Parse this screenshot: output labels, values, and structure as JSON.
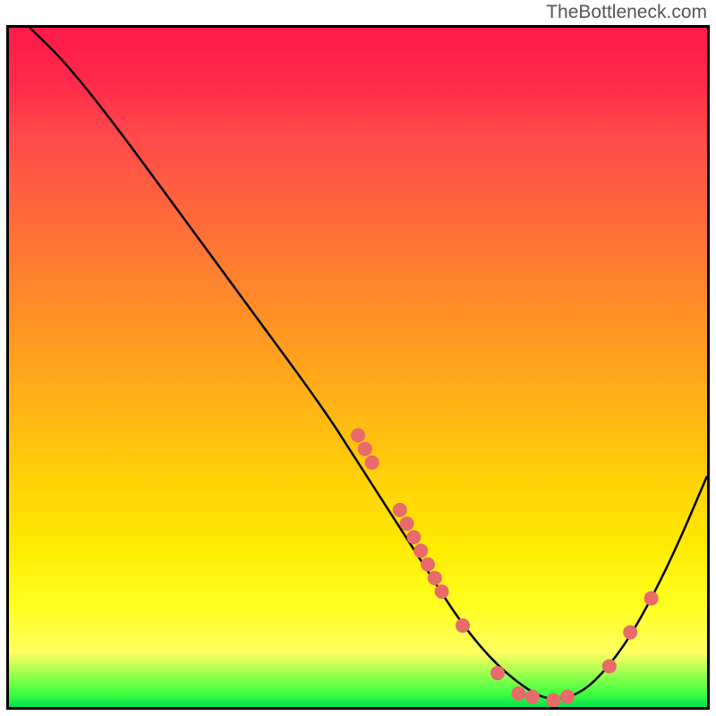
{
  "watermark": "TheBottleneck.com",
  "chart_data": {
    "type": "line",
    "title": "",
    "xlabel": "",
    "ylabel": "",
    "xlim": [
      0,
      100
    ],
    "ylim": [
      0,
      100
    ],
    "curve": [
      {
        "x": 3,
        "y": 100
      },
      {
        "x": 8,
        "y": 95
      },
      {
        "x": 15,
        "y": 86
      },
      {
        "x": 25,
        "y": 72
      },
      {
        "x": 35,
        "y": 58
      },
      {
        "x": 45,
        "y": 44
      },
      {
        "x": 50,
        "y": 36
      },
      {
        "x": 55,
        "y": 28
      },
      {
        "x": 60,
        "y": 20
      },
      {
        "x": 65,
        "y": 12
      },
      {
        "x": 70,
        "y": 6
      },
      {
        "x": 75,
        "y": 2
      },
      {
        "x": 78,
        "y": 1
      },
      {
        "x": 82,
        "y": 2
      },
      {
        "x": 86,
        "y": 6
      },
      {
        "x": 90,
        "y": 12
      },
      {
        "x": 95,
        "y": 22
      },
      {
        "x": 100,
        "y": 34
      }
    ],
    "points": [
      {
        "x": 50,
        "y": 40
      },
      {
        "x": 51,
        "y": 38
      },
      {
        "x": 52,
        "y": 36
      },
      {
        "x": 56,
        "y": 29
      },
      {
        "x": 57,
        "y": 27
      },
      {
        "x": 58,
        "y": 25
      },
      {
        "x": 59,
        "y": 23
      },
      {
        "x": 60,
        "y": 21
      },
      {
        "x": 61,
        "y": 19
      },
      {
        "x": 62,
        "y": 17
      },
      {
        "x": 65,
        "y": 12
      },
      {
        "x": 70,
        "y": 5
      },
      {
        "x": 73,
        "y": 2
      },
      {
        "x": 75,
        "y": 1.5
      },
      {
        "x": 78,
        "y": 1
      },
      {
        "x": 80,
        "y": 1.5
      },
      {
        "x": 86,
        "y": 6
      },
      {
        "x": 89,
        "y": 11
      },
      {
        "x": 92,
        "y": 16
      }
    ],
    "point_color": "#e86a6a",
    "curve_color": "#000000"
  }
}
